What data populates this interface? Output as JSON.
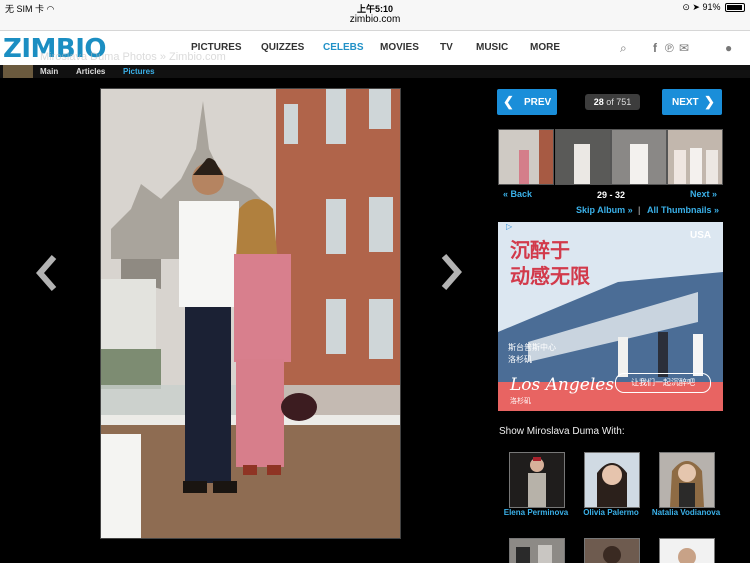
{
  "status": {
    "carrier": "无 SIM 卡",
    "time": "上午5:10",
    "battery": "91%",
    "battery_level": 0.91
  },
  "browser": {
    "url": "zimbio.com"
  },
  "header": {
    "logo": "ZIMBIO",
    "nav": [
      "PICTURES",
      "QUIZZES",
      "CELEBS",
      "MOVIES",
      "TV",
      "MUSIC",
      "MORE"
    ],
    "active": "CELEBS"
  },
  "subnav": {
    "items": [
      "Main",
      "Articles",
      "Pictures"
    ]
  },
  "page": {
    "ghost_title": "Miroslava Duma Photos » Zimbio.com"
  },
  "gallery": {
    "prev_label": "PREV",
    "next_label": "NEXT",
    "current": "28",
    "of_label": "of",
    "total": "751",
    "back_label": "« Back",
    "next_small_label": "Next »",
    "range": "29 - 32",
    "skip_album": "Skip Album »",
    "divider": "|",
    "all_thumbnails": "All Thumbnails »"
  },
  "ad": {
    "headline_1": "沉醉于",
    "headline_2": "动感无限",
    "brand": "USA",
    "sub_1": "斯台普斯中心",
    "sub_2": "洛杉矶",
    "script": "Los Angeles",
    "script_cn": "洛杉矶",
    "cta": "让我们一起沉醉吧"
  },
  "related": {
    "title": "Show Miroslava Duma With:",
    "people": [
      "Elena Perminova",
      "Olivia Palermo",
      "Natalia Vodianova"
    ]
  },
  "colors": {
    "accent": "#1a8ed9",
    "link": "#3ab0e8",
    "background": "#000000"
  }
}
